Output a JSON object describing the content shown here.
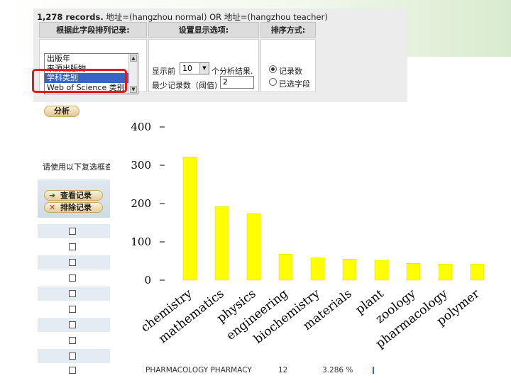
{
  "header": {
    "records_count": "1,278 records.",
    "query": "地址=(hangzhou normal) OR 地址=(hangzhou teacher)"
  },
  "rank_panel": {
    "field_heading": "根据此字段排列记录:",
    "field_options": [
      "出版年",
      "来源出版物",
      "学科类别",
      "Web of Science 类别"
    ],
    "selected_field": "学科类别",
    "display_heading": "设置显示选项:",
    "show_top_prefix": "显示前",
    "show_top_value": "10",
    "show_top_suffix": "个分析结果.",
    "min_count_label": "最少记录数（阈值)",
    "min_count_value": "2",
    "sort_heading": "排序方式:",
    "sort_options": [
      "记录数",
      "已选字段"
    ],
    "sort_selected": "记录数",
    "analyze_button": "分析"
  },
  "results_panel": {
    "hint": "请使用以下复选框查",
    "view_records_button": "查看记录",
    "exclude_records_button": "排除记录",
    "footer_row": {
      "field_value": "PHARMACOLOGY PHARMACY",
      "count": "12",
      "percent": "3.286 %"
    }
  },
  "colors": {
    "bar_fill": "#ffff00",
    "selection": "#3566c6",
    "highlight_box": "#e11a1a",
    "wos_panel": "#ececec"
  },
  "chart_data": {
    "type": "bar",
    "categories": [
      "chemistry",
      "mathematics",
      "physics",
      "engineering",
      "biochemistry",
      "materials",
      "plant",
      "zoology",
      "pharmacology",
      "polymer"
    ],
    "values": [
      322,
      192,
      174,
      68,
      58,
      55,
      52,
      44,
      42,
      42
    ],
    "title": "",
    "xlabel": "",
    "ylabel": "",
    "ylim": [
      0,
      400
    ],
    "yticks": [
      "0",
      "100",
      "200",
      "300",
      "400"
    ],
    "grid": false,
    "legend": "none"
  }
}
